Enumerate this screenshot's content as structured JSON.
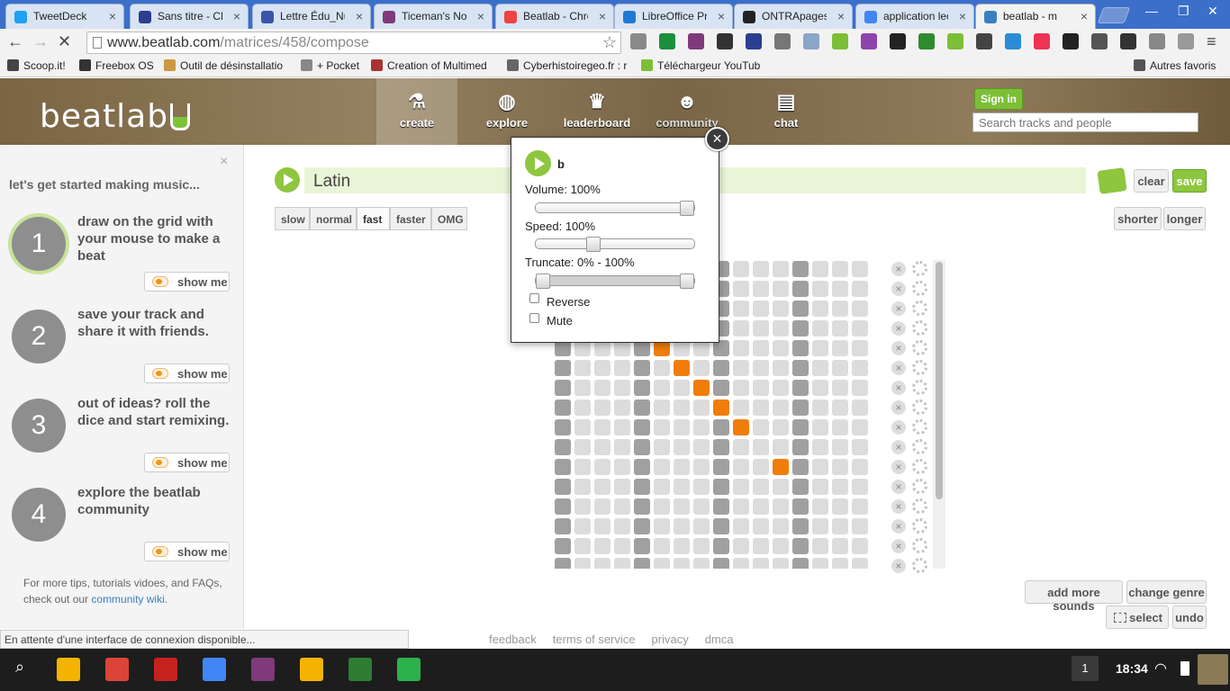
{
  "browser": {
    "tabs": [
      {
        "title": "TweetDeck",
        "icon_color": "#1da1f2",
        "active": false
      },
      {
        "title": "Sans titre - CLI",
        "icon_color": "#2c3e8f",
        "active": false
      },
      {
        "title": "Lettre Édu_Nu",
        "icon_color": "#3a54a8",
        "active": false
      },
      {
        "title": "Ticeman's Not",
        "icon_color": "#80397b",
        "active": false
      },
      {
        "title": "Beatlab - Chro",
        "icon_color": "#e44",
        "active": false
      },
      {
        "title": "LibreOffice Pro",
        "icon_color": "#1e7ad2",
        "active": false
      },
      {
        "title": "ONTRApages l",
        "icon_color": "#222",
        "active": false
      },
      {
        "title": "application lec",
        "icon_color": "#4285f4",
        "active": false
      },
      {
        "title": "beatlab - m",
        "icon_color": "#3a7fc0",
        "active": true
      }
    ],
    "url_host": "www.beatlab.com",
    "url_path": "/matrices/458/compose",
    "bookmarks": [
      {
        "label": "Scoop.it!",
        "icon_color": "#444"
      },
      {
        "label": "Freebox OS",
        "icon_color": "#333"
      },
      {
        "label": "Outil de désinstallatio",
        "icon_color": "#c94"
      },
      {
        "label": "+ Pocket",
        "icon_color": "#888"
      },
      {
        "label": "Creation of Multimed",
        "icon_color": "#a33"
      },
      {
        "label": "Cyberhistoiregeo.fr : r",
        "icon_color": "#666"
      },
      {
        "label": "Téléchargeur YouTub",
        "icon_color": "#7cbf36"
      },
      {
        "label": "Autres favoris",
        "icon_color": "#555"
      }
    ]
  },
  "site": {
    "logo": "beatlab",
    "nav": [
      {
        "label": "create",
        "icon": "flask-icon",
        "active": true
      },
      {
        "label": "explore",
        "icon": "globe-icon",
        "active": false
      },
      {
        "label": "leaderboard",
        "icon": "crown-icon",
        "active": false
      },
      {
        "label": "community",
        "icon": "people-icon",
        "active": false
      },
      {
        "label": "chat",
        "icon": "chat-icon",
        "active": false
      }
    ],
    "signin": "Sign in",
    "search_placeholder": "Search tracks and people"
  },
  "sidebar": {
    "close": "×",
    "title": "let's get started making music...",
    "steps": [
      {
        "num": "1",
        "text": "draw on the grid with your mouse to make a beat",
        "button": "show me"
      },
      {
        "num": "2",
        "text": "save your track and share it with friends.",
        "button": "show me"
      },
      {
        "num": "3",
        "text": "out of ideas? roll the dice and start remixing.",
        "button": "show me"
      },
      {
        "num": "4",
        "text": "explore the beatlab community",
        "button": "show me"
      }
    ],
    "footer_text": "For more tips, tutorials vidoes, and FAQs, check out our",
    "footer_link": "community wiki."
  },
  "composer": {
    "track_name": "Latin",
    "clear": "clear",
    "save": "save",
    "tempos": [
      "slow",
      "normal",
      "fast",
      "faster",
      "OMG"
    ],
    "selected_tempo": "fast",
    "shorter": "shorter",
    "longer": "longer",
    "add_more_sounds": "add more sounds",
    "change_genre": "change genre",
    "select": "select",
    "undo": "undo",
    "active_color": "#f07d0a",
    "grid": {
      "columns": 16,
      "visible_rows": 16,
      "active_cells": [
        [
          4,
          5
        ],
        [
          5,
          6
        ],
        [
          6,
          7
        ],
        [
          7,
          8
        ],
        [
          8,
          9
        ],
        [
          10,
          11
        ]
      ]
    }
  },
  "popup": {
    "close": "×",
    "name": "b",
    "volume_label": "Volume: 100%",
    "volume": 1.0,
    "speed_label": "Speed: 100%",
    "speed": 0.35,
    "truncate_label": "Truncate: 0% - 100%",
    "truncate_start": 0.0,
    "truncate_end": 1.0,
    "reverse_label": "Reverse",
    "mute_label": "Mute"
  },
  "footer": {
    "links": [
      "feedback",
      "terms of service",
      "privacy",
      "dmca"
    ]
  },
  "statusbar": "En attente d'une interface de connexion disponible...",
  "taskbar": {
    "apps": [
      "search-icon",
      "drive-icon",
      "chrome-icon",
      "gmail-icon",
      "docs-icon",
      "onenote-icon",
      "slides-icon",
      "app-icon",
      "feedly-icon"
    ],
    "notification_count": "1",
    "time": "18:34"
  }
}
